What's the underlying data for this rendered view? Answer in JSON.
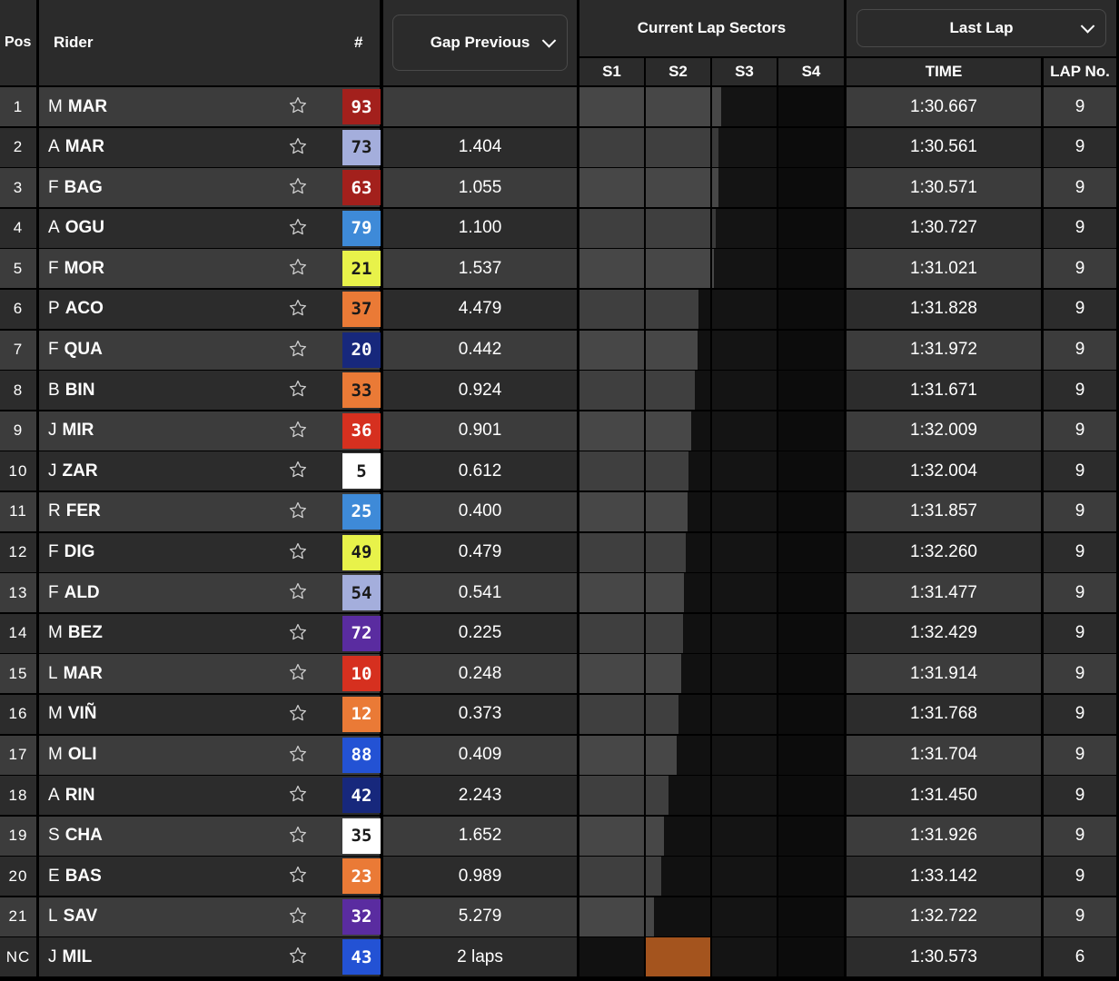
{
  "header": {
    "pos": "Pos",
    "rider": "Rider",
    "number": "#",
    "gap_dropdown": "Gap Previous",
    "sectors_title": "Current Lap Sectors",
    "sectors": [
      "S1",
      "S2",
      "S3",
      "S4"
    ],
    "lap_dropdown": "Last Lap",
    "time": "TIME",
    "lap_no": "LAP No."
  },
  "colors": {
    "header_bg": "#2b2b2b",
    "row_odd": "#3c3c3c",
    "row_even": "#2c2c2c",
    "sector_done": "#474747",
    "sector_pending_s3": "#141414",
    "sector_pending_s4": "#0c0c0c",
    "sector_highlight": "#a4541e"
  },
  "riders": [
    {
      "pos": "1",
      "first": "M",
      "last": "MAR",
      "num": "93",
      "num_bg": "#a3201c",
      "num_fg": "#ffffff",
      "gap": "",
      "time": "1:30.667",
      "lap": "9",
      "progress": 0.26
    },
    {
      "pos": "2",
      "first": "A",
      "last": "MAR",
      "num": "73",
      "num_bg": "#a4aedc",
      "num_fg": "#1a1a1a",
      "gap": "1.404",
      "time": "1:30.561",
      "lap": "9",
      "progress": 0.19
    },
    {
      "pos": "3",
      "first": "F",
      "last": "BAG",
      "num": "63",
      "num_bg": "#a3201c",
      "num_fg": "#ffffff",
      "gap": "1.055",
      "time": "1:30.571",
      "lap": "9",
      "progress": 0.17
    },
    {
      "pos": "4",
      "first": "A",
      "last": "OGU",
      "num": "79",
      "num_bg": "#3e8ad8",
      "num_fg": "#ffffff",
      "gap": "1.100",
      "time": "1:30.727",
      "lap": "9",
      "progress": 0.1
    },
    {
      "pos": "5",
      "first": "F",
      "last": "MOR",
      "num": "21",
      "num_bg": "#e8f24a",
      "num_fg": "#1a1a1a",
      "gap": "1.537",
      "time": "1:31.021",
      "lap": "9",
      "progress": 0.06
    },
    {
      "pos": "6",
      "first": "P",
      "last": "ACO",
      "num": "37",
      "num_bg": "#ea7a36",
      "num_fg": "#1a1a1a",
      "gap": "4.479",
      "time": "1:31.828",
      "lap": "9",
      "progress": -0.16
    },
    {
      "pos": "7",
      "first": "F",
      "last": "QUA",
      "num": "20",
      "num_bg": "#17287c",
      "num_fg": "#ffffff",
      "gap": "0.442",
      "time": "1:31.972",
      "lap": "9",
      "progress": -0.17
    },
    {
      "pos": "8",
      "first": "B",
      "last": "BIN",
      "num": "33",
      "num_bg": "#ea7a36",
      "num_fg": "#1a1a1a",
      "gap": "0.924",
      "time": "1:31.671",
      "lap": "9",
      "progress": -0.22
    },
    {
      "pos": "9",
      "first": "J",
      "last": "MIR",
      "num": "36",
      "num_bg": "#d6301f",
      "num_fg": "#ffffff",
      "gap": "0.901",
      "time": "1:32.009",
      "lap": "9",
      "progress": -0.26
    },
    {
      "pos": "10",
      "first": "J",
      "last": "ZAR",
      "num": "5",
      "num_bg": "#ffffff",
      "num_fg": "#1a1a1a",
      "gap": "0.612",
      "time": "1:32.004",
      "lap": "9",
      "progress": -0.3
    },
    {
      "pos": "11",
      "first": "R",
      "last": "FER",
      "num": "25",
      "num_bg": "#3e8ad8",
      "num_fg": "#ffffff",
      "gap": "0.400",
      "time": "1:31.857",
      "lap": "9",
      "progress": -0.32
    },
    {
      "pos": "12",
      "first": "F",
      "last": "DIG",
      "num": "49",
      "num_bg": "#e8f24a",
      "num_fg": "#1a1a1a",
      "gap": "0.479",
      "time": "1:32.260",
      "lap": "9",
      "progress": -0.34
    },
    {
      "pos": "13",
      "first": "F",
      "last": "ALD",
      "num": "54",
      "num_bg": "#a4aedc",
      "num_fg": "#1a1a1a",
      "gap": "0.541",
      "time": "1:31.477",
      "lap": "9",
      "progress": -0.36
    },
    {
      "pos": "14",
      "first": "M",
      "last": "BEZ",
      "num": "72",
      "num_bg": "#5a2ca0",
      "num_fg": "#ffffff",
      "gap": "0.225",
      "time": "1:32.429",
      "lap": "9",
      "progress": -0.38
    },
    {
      "pos": "15",
      "first": "L",
      "last": "MAR",
      "num": "10",
      "num_bg": "#d6301f",
      "num_fg": "#ffffff",
      "gap": "0.248",
      "time": "1:31.914",
      "lap": "9",
      "progress": -0.4
    },
    {
      "pos": "16",
      "first": "M",
      "last": "VIÑ",
      "num": "12",
      "num_bg": "#ea7a36",
      "num_fg": "#ffffff",
      "gap": "0.373",
      "time": "1:31.768",
      "lap": "9",
      "progress": -0.44
    },
    {
      "pos": "17",
      "first": "M",
      "last": "OLI",
      "num": "88",
      "num_bg": "#2352d4",
      "num_fg": "#ffffff",
      "gap": "0.409",
      "time": "1:31.704",
      "lap": "9",
      "progress": -0.46
    },
    {
      "pos": "18",
      "first": "A",
      "last": "RIN",
      "num": "42",
      "num_bg": "#17287c",
      "num_fg": "#ffffff",
      "gap": "2.243",
      "time": "1:31.450",
      "lap": "9",
      "progress": -0.58
    },
    {
      "pos": "19",
      "first": "S",
      "last": "CHA",
      "num": "35",
      "num_bg": "#ffffff",
      "num_fg": "#1a1a1a",
      "gap": "1.652",
      "time": "1:31.926",
      "lap": "9",
      "progress": -0.64
    },
    {
      "pos": "20",
      "first": "E",
      "last": "BAS",
      "num": "23",
      "num_bg": "#ea7a36",
      "num_fg": "#ffffff",
      "gap": "0.989",
      "time": "1:33.142",
      "lap": "9",
      "progress": -0.68
    },
    {
      "pos": "21",
      "first": "L",
      "last": "SAV",
      "num": "32",
      "num_bg": "#5a2ca0",
      "num_fg": "#ffffff",
      "gap": "5.279",
      "time": "1:32.722",
      "lap": "9",
      "progress": -0.78
    },
    {
      "pos": "NC",
      "first": "J",
      "last": "MIL",
      "num": "43",
      "num_bg": "#2352d4",
      "num_fg": "#ffffff",
      "gap": "2 laps",
      "time": "1:30.573",
      "lap": "6",
      "progress": -1,
      "highlight_s2": true
    }
  ]
}
